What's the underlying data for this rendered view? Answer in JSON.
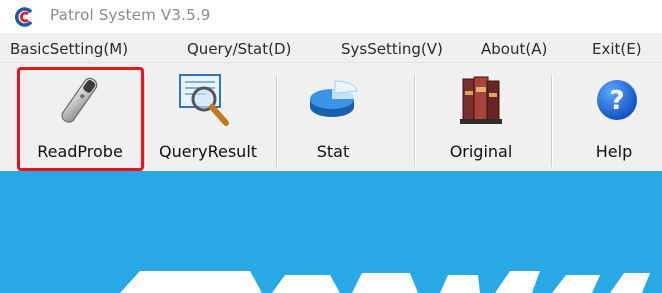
{
  "window": {
    "title": "Patrol System V3.5.9",
    "icon": "app-logo-icon"
  },
  "menu": {
    "items": [
      {
        "label": "BasicSetting(M)"
      },
      {
        "label": "Query/Stat(D)"
      },
      {
        "label": "SysSetting(V)"
      },
      {
        "label": "About(A)"
      },
      {
        "label": "Exit(E)"
      }
    ]
  },
  "toolbar": {
    "buttons": [
      {
        "label": "ReadProbe",
        "icon": "probe-reader-icon",
        "highlighted": true
      },
      {
        "label": "QueryResult",
        "icon": "magnifier-monitor-icon"
      },
      {
        "label": "Stat",
        "icon": "pie-chart-icon"
      },
      {
        "label": "Original",
        "icon": "books-icon"
      },
      {
        "label": "Help",
        "icon": "help-icon"
      }
    ]
  },
  "colors": {
    "highlight_border": "#e8141a",
    "content_background": "#29a8e6",
    "menubar_background": "#f0f0f0"
  }
}
